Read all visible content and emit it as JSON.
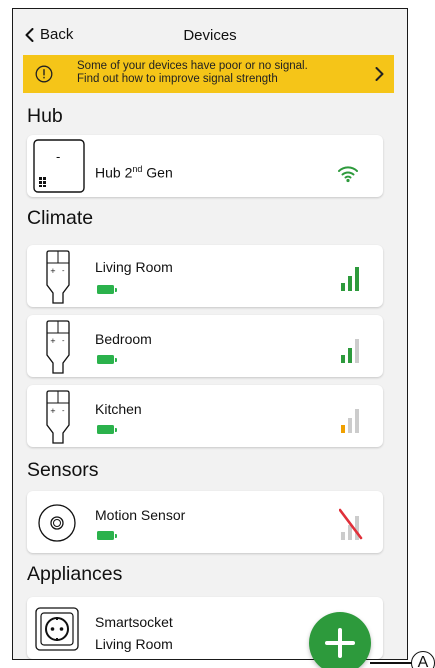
{
  "header": {
    "back_label": "Back",
    "title": "Devices"
  },
  "banner": {
    "line1": "Some of your devices have poor or no signal.",
    "line2": "Find out how to improve signal strength",
    "color": "#f5c518"
  },
  "sections": {
    "hub": "Hub",
    "climate": "Climate",
    "sensors": "Sensors",
    "appliances": "Appliances"
  },
  "devices": {
    "hub": {
      "name": "Hub 2",
      "sup": "nd",
      "suffix": " Gen",
      "device_label": "-",
      "signal": "wifi-strong"
    },
    "living_room": {
      "name": "Living Room",
      "battery": "full",
      "signal_bars": 3
    },
    "bedroom": {
      "name": "Bedroom",
      "battery": "full",
      "signal_bars": 2
    },
    "kitchen": {
      "name": "Kitchen",
      "battery": "full",
      "signal_bars": 1
    },
    "motion_sensor": {
      "name": "Motion Sensor",
      "battery": "full",
      "signal_bars": 0
    },
    "smartsocket": {
      "name_line1": "Smartsocket",
      "name_line2": "Living Room"
    }
  },
  "fab": {
    "icon": "plus-icon",
    "color": "#2d9a3c"
  },
  "callout": {
    "label": "A"
  },
  "colors": {
    "signal_good": "#2d9a3c",
    "signal_weak": "#f0a000",
    "signal_none": "#e0303a",
    "signal_inactive": "#cccccc",
    "battery": "#2bb24c"
  }
}
